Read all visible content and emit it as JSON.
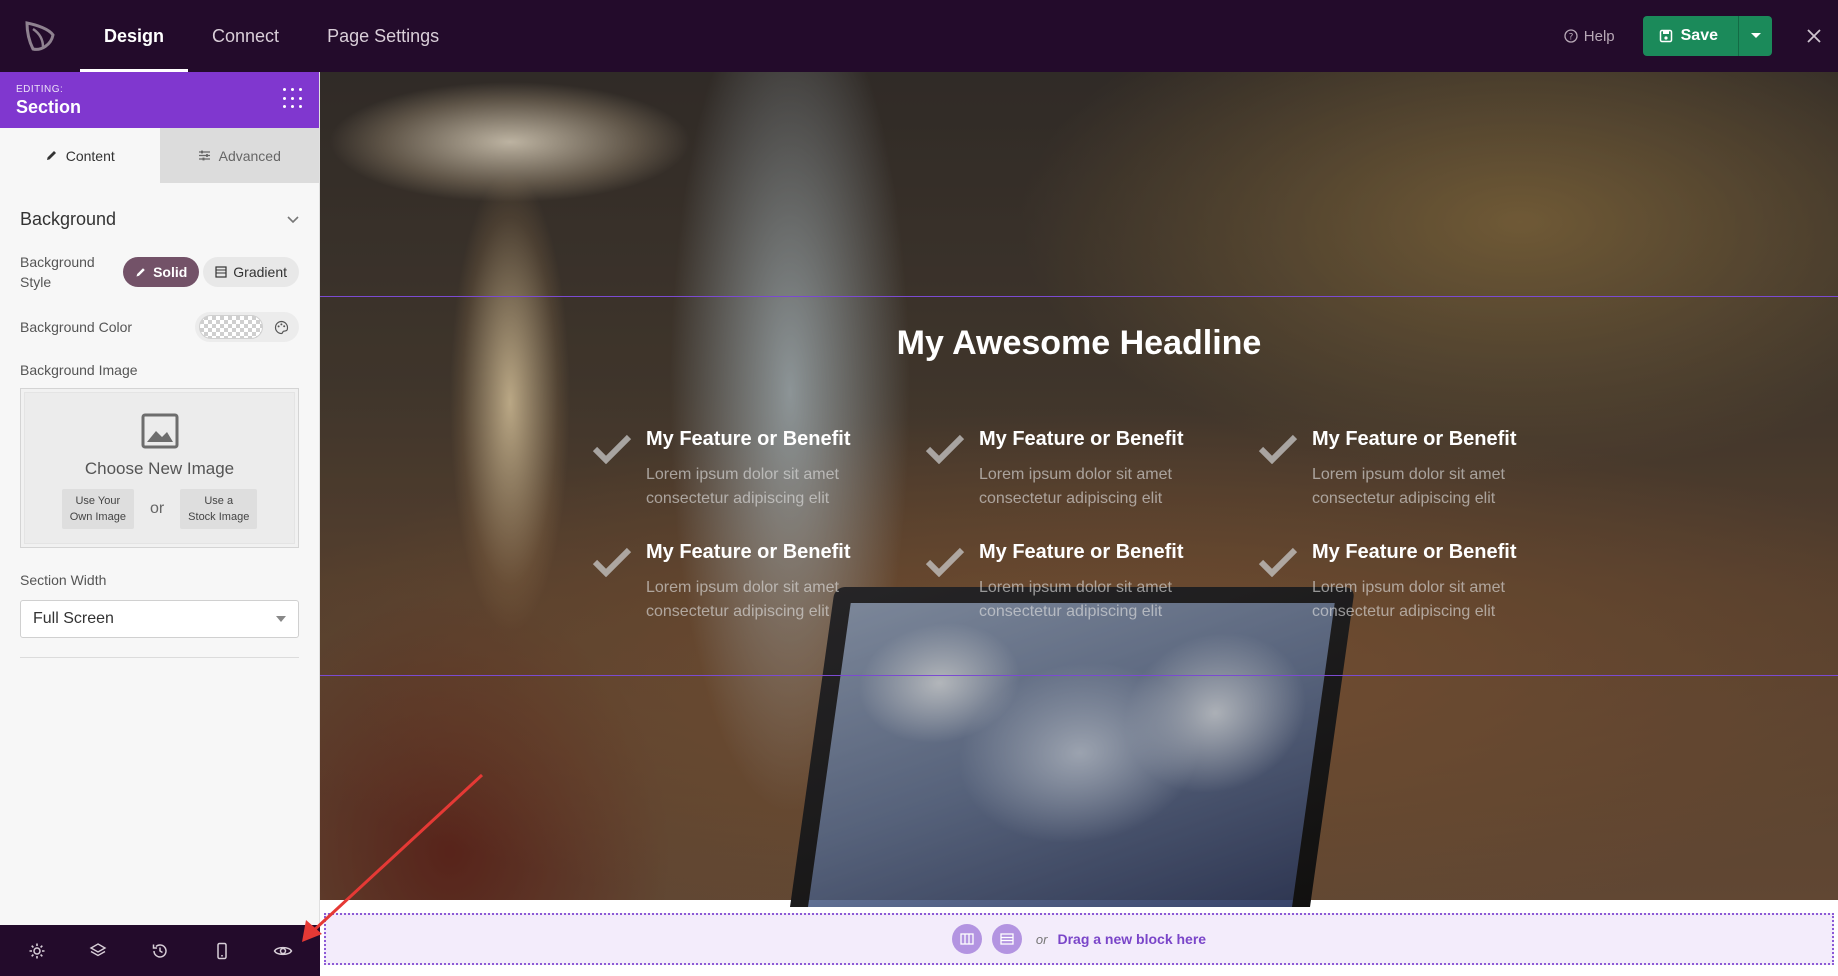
{
  "colors": {
    "topbar": "#230b2b",
    "accent_purple": "#8037cf",
    "save_green": "#1b8a5a",
    "solid_pill": "#735268",
    "annotation_arrow": "#e53935"
  },
  "topbar": {
    "tabs": [
      {
        "label": "Design",
        "active": true
      },
      {
        "label": "Connect",
        "active": false
      },
      {
        "label": "Page Settings",
        "active": false
      }
    ],
    "help_label": "Help",
    "save_label": "Save"
  },
  "sidebar": {
    "editing_label": "EDITING:",
    "editing_target": "Section",
    "tabs": {
      "content": "Content",
      "advanced": "Advanced"
    },
    "background": {
      "heading": "Background",
      "style_label": "Background Style",
      "style_solid": "Solid",
      "style_gradient": "Gradient",
      "color_label": "Background Color",
      "image_label": "Background Image",
      "choose_image": "Choose New Image",
      "own_image_line1": "Use Your",
      "own_image_line2": "Own Image",
      "or": "or",
      "stock_image_line1": "Use a",
      "stock_image_line2": "Stock Image"
    },
    "section_width": {
      "label": "Section Width",
      "value": "Full Screen"
    }
  },
  "canvas": {
    "headline": "My Awesome Headline",
    "features": [
      {
        "title": "My Feature or Benefit",
        "body": "Lorem ipsum dolor sit amet consectetur adipiscing elit"
      },
      {
        "title": "My Feature or Benefit",
        "body": "Lorem ipsum dolor sit amet consectetur adipiscing elit"
      },
      {
        "title": "My Feature or Benefit",
        "body": "Lorem ipsum dolor sit amet consectetur adipiscing elit"
      },
      {
        "title": "My Feature or Benefit",
        "body": "Lorem ipsum dolor sit amet consectetur adipiscing elit"
      },
      {
        "title": "My Feature or Benefit",
        "body": "Lorem ipsum dolor sit amet consectetur adipiscing elit"
      },
      {
        "title": "My Feature or Benefit",
        "body": "Lorem ipsum dolor sit amet consectetur adipiscing elit"
      }
    ],
    "drop_zone": {
      "or": "or",
      "text": "Drag a new block here"
    }
  },
  "bottom_bar": {
    "icons": [
      "gear-icon",
      "layers-icon",
      "history-icon",
      "mobile-icon",
      "eye-icon"
    ]
  }
}
